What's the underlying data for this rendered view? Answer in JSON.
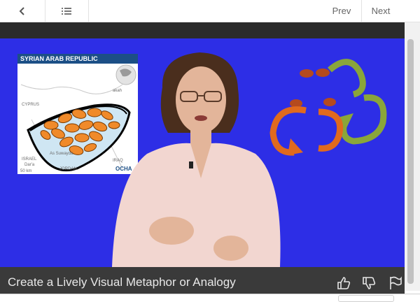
{
  "nav": {
    "prev_label": "Prev",
    "next_label": "Next",
    "back_icon": "chevron-left-icon",
    "list_icon": "list-icon"
  },
  "video": {
    "background_color": "#2d2ee6",
    "map": {
      "header": "SYRIAN ARAB REPUBLIC",
      "labels": [
        "CYPRUS",
        "IRAQ",
        "ISRAEL",
        "JORDAN",
        "As Suwayda",
        "Dar'a",
        "50 km",
        "OCHA",
        "akah"
      ]
    },
    "title": "Create a Lively Visual Metaphor or Analogy"
  },
  "caption_actions": {
    "like_icon": "thumbs-up-icon",
    "dislike_icon": "thumbs-down-icon",
    "flag_icon": "flag-icon"
  }
}
